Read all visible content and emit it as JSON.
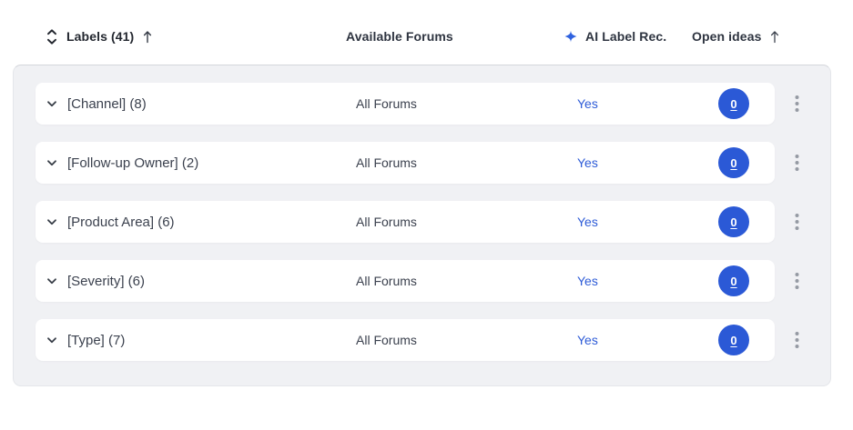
{
  "header": {
    "labels_column": "Labels (41)",
    "available_forums_column": "Available Forums",
    "ai_label_rec_column": "AI Label Rec.",
    "open_ideas_column": "Open ideas"
  },
  "icons": {
    "sort_unfold": "double-chevron-up-down",
    "labels_sort_direction": "arrow-up",
    "open_ideas_sort_direction": "arrow-up",
    "ai_sparkle": "four-point-star",
    "row_expand": "chevron-down",
    "row_menu": "kebab-vertical-dots"
  },
  "rows": [
    {
      "label": "[Channel] (8)",
      "available_forums": "All Forums",
      "ai_label_rec": "Yes",
      "open_ideas": "0"
    },
    {
      "label": "[Follow-up Owner] (2)",
      "available_forums": "All Forums",
      "ai_label_rec": "Yes",
      "open_ideas": "0"
    },
    {
      "label": "[Product Area] (6)",
      "available_forums": "All Forums",
      "ai_label_rec": "Yes",
      "open_ideas": "0"
    },
    {
      "label": "[Severity] (6)",
      "available_forums": "All Forums",
      "ai_label_rec": "Yes",
      "open_ideas": "0"
    },
    {
      "label": "[Type] (7)",
      "available_forums": "All Forums",
      "ai_label_rec": "Yes",
      "open_ideas": "0"
    }
  ],
  "colors": {
    "accent_blue": "#2d5bd7",
    "badge_blue": "#2b59d6",
    "panel_background": "#f0f1f4",
    "card_background": "#ffffff",
    "header_text": "#23272f",
    "row_text": "#3b414e",
    "kebab_gray": "#959aa3"
  }
}
